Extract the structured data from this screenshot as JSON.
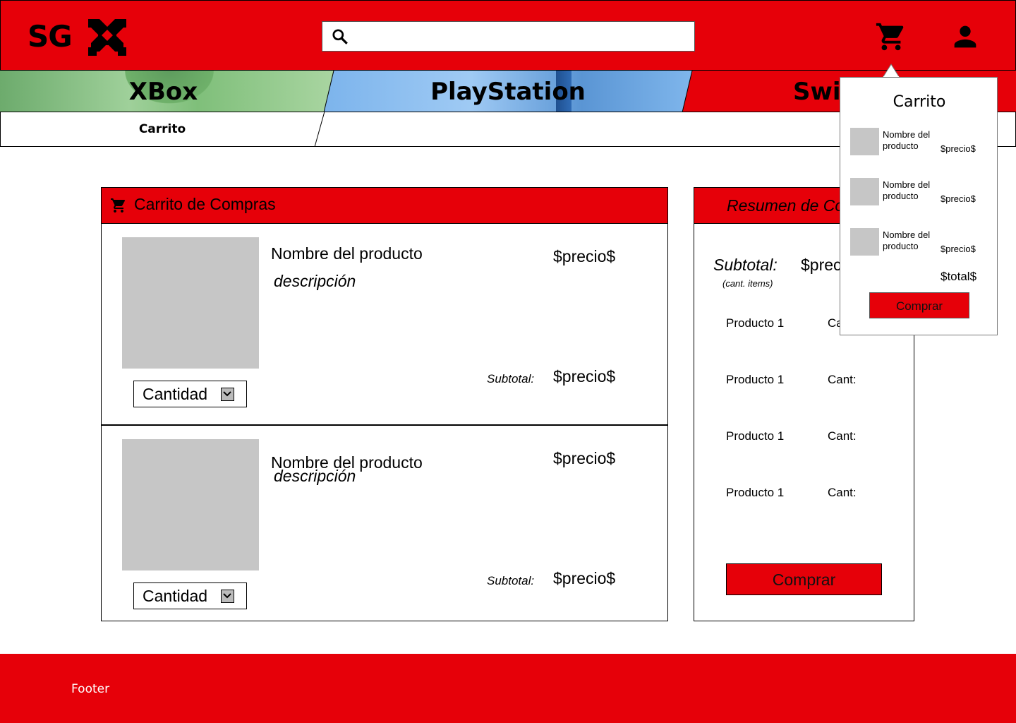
{
  "header": {
    "logo_text": "SG",
    "search_placeholder": "",
    "icons": [
      "search-icon",
      "cart-icon",
      "user-icon"
    ]
  },
  "categories": [
    "XBox",
    "PlayStation",
    "Switch"
  ],
  "categories_visible": [
    "XBox",
    "PlayStation",
    "Swi"
  ],
  "breadcrumb": "Carrito",
  "cart": {
    "title": "Carrito de Compras",
    "items": [
      {
        "name": "Nombre del producto",
        "description": "descripción",
        "price": "$precio$",
        "subtotal_label": "Subtotal:",
        "subtotal": "$precio$",
        "quantity_label": "Cantidad"
      },
      {
        "name": "Nombre del producto",
        "description": "descripción",
        "price": "$precio$",
        "subtotal_label": "Subtotal:",
        "subtotal": "$precio$",
        "quantity_label": "Cantidad"
      }
    ]
  },
  "summary": {
    "title": "Resumen de Co",
    "subtotal_label": "Subtotal:",
    "items_label": "(cant. items)",
    "subtotal_value": "$prec",
    "rows": [
      {
        "product": "Producto 1",
        "qty": "Ca"
      },
      {
        "product": "Producto 1",
        "qty": "Cant:"
      },
      {
        "product": "Producto 1",
        "qty": "Cant:"
      },
      {
        "product": "Producto 1",
        "qty": "Cant:"
      }
    ],
    "buy_label": "Comprar"
  },
  "popover": {
    "title": "Carrito",
    "items": [
      {
        "name": "Nombre del producto",
        "price": "$precio$"
      },
      {
        "name": "Nombre del producto",
        "price": "$precio$"
      },
      {
        "name": "Nombre del producto",
        "price": "$precio$"
      }
    ],
    "total": "$total$",
    "buy_label": "Comprar"
  },
  "footer": {
    "text": "Footer"
  },
  "colors": {
    "brand_red": "#e60009",
    "placeholder_gray": "#c6c6c6",
    "xbox_green": "#8cc987",
    "playstation_blue": "#7cb4ec"
  }
}
